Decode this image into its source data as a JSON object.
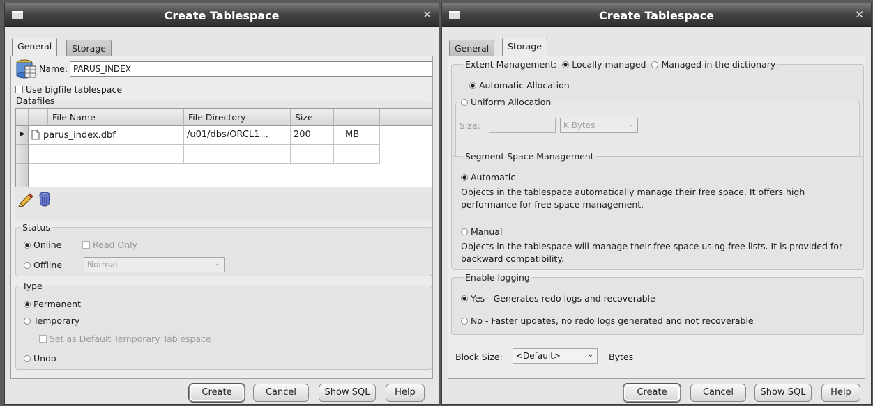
{
  "left_window": {
    "title": "Create Tablespace",
    "tabs": [
      "General",
      "Storage"
    ],
    "active_tab": "General",
    "name_label": "Name:",
    "name_value": "PARUS_INDEX",
    "bigfile_label": "Use bigfile tablespace",
    "datafiles": {
      "legend": "Datafiles",
      "columns": [
        "File Name",
        "File Directory",
        "Size"
      ],
      "rows": [
        {
          "file_name": "parus_index.dbf",
          "directory": "/u01/dbs/ORCL1...",
          "size": "200",
          "unit": "MB"
        }
      ]
    },
    "status": {
      "legend": "Status",
      "online": "Online",
      "read_only": "Read Only",
      "offline": "Offline",
      "offline_mode": "Normal"
    },
    "type": {
      "legend": "Type",
      "permanent": "Permanent",
      "temporary": "Temporary",
      "default_temp": "Set as Default Temporary Tablespace",
      "undo": "Undo"
    },
    "buttons": {
      "create": "Create",
      "cancel": "Cancel",
      "show_sql": "Show SQL",
      "help": "Help"
    }
  },
  "right_window": {
    "title": "Create Tablespace",
    "tabs": [
      "General",
      "Storage"
    ],
    "active_tab": "Storage",
    "extent": {
      "legend_label": "Extent Management:",
      "locally": "Locally managed",
      "dictionary": "Managed in the dictionary",
      "automatic_allocation": "Automatic Allocation",
      "uniform_allocation": "Uniform Allocation",
      "size_label": "Size:",
      "size_value": "",
      "size_unit": "K Bytes"
    },
    "segment": {
      "legend": "Segment Space Management",
      "automatic": "Automatic",
      "automatic_desc": "Objects in the tablespace automatically manage their free space. It offers high performance for free space management.",
      "manual": "Manual",
      "manual_desc": "Objects in the tablespace will manage their free space using free lists. It is provided for backward compatibility."
    },
    "logging": {
      "legend": "Enable logging",
      "yes": "Yes - Generates redo logs and recoverable",
      "no": "No - Faster updates, no redo logs generated and not recoverable"
    },
    "block_size": {
      "label": "Block Size:",
      "value": "<Default>",
      "unit": "Bytes"
    },
    "buttons": {
      "create": "Create",
      "cancel": "Cancel",
      "show_sql": "Show SQL",
      "help": "Help"
    }
  },
  "icons": {
    "window_menu": "window-menu-icon",
    "close": "close-icon",
    "tablespace": "database-tablespace-icon",
    "datafile": "document-icon",
    "edit": "pencil-icon",
    "delete": "trash-icon"
  }
}
